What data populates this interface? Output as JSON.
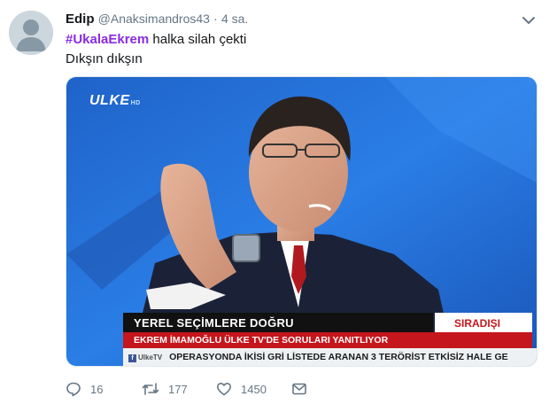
{
  "tweet": {
    "author_name": "Edip",
    "handle": "@Anaksimandros43",
    "separator": "·",
    "time": "4 sa.",
    "hashtag": "#UkalaEkrem",
    "line1_rest": " halka silah çekti",
    "line2": "Dıkşın dıkşın"
  },
  "media": {
    "channel_logo": "ULKE",
    "channel_logo_sub": "HD",
    "ticker_title": "YEREL SEÇİMLERE DOĞRU",
    "ticker_tag": "SIRADIŞI",
    "ticker_sub": "EKREM İMAMOĞLU ÜLKE TV'DE SORULARI YANITLIYOR",
    "ticker_source": "UlkeTV",
    "ticker_crawl": "OPERASYONDA İKİSİ GRİ LİSTEDE ARANAN 3 TERÖRİST ETKİSİZ HALE GE"
  },
  "actions": {
    "reply_count": "16",
    "retweet_count": "177",
    "like_count": "1450"
  },
  "colors": {
    "hashtag": "#8a2be2",
    "muted": "#657786",
    "ticker_red": "#c4161c"
  },
  "icons": [
    "avatar-silhouette",
    "chevron-down-icon",
    "reply-icon",
    "retweet-icon",
    "like-icon",
    "message-icon"
  ]
}
